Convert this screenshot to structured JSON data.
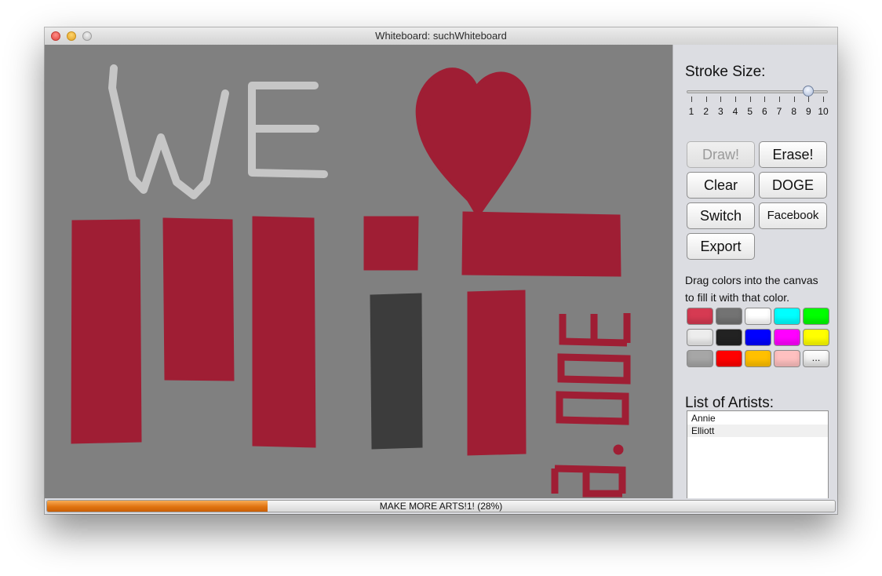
{
  "window": {
    "title": "Whiteboard: suchWhiteboard"
  },
  "controls": {
    "stroke_label": "Stroke Size:",
    "stroke": {
      "min": 1,
      "max": 10,
      "value": 9,
      "ticks": [
        "1",
        "2",
        "3",
        "4",
        "5",
        "6",
        "7",
        "8",
        "9",
        "10"
      ]
    },
    "buttons": {
      "draw": "Draw!",
      "erase": "Erase!",
      "clear": "Clear",
      "doge": "DOGE",
      "switch": "Switch",
      "facebook": "Facebook",
      "export": "Export"
    },
    "hint_line1": "Drag colors into the canvas",
    "hint_line2": "to fill it with that color.",
    "palette": [
      "#d63a52",
      "#737373",
      "#ffffff",
      "#00ffff",
      "#00ff00",
      "#ededed",
      "#222222",
      "#0000ff",
      "#ff00ff",
      "#ffff00",
      "#a6a6a6",
      "#ff0000",
      "#ffc000",
      "#ffc0c0"
    ],
    "palette_more": "...",
    "artists_label": "List of Artists:",
    "artists": [
      "Annie",
      "Elliott"
    ]
  },
  "canvas": {
    "background": "#808080",
    "ink": {
      "red": "#9f1e34",
      "light": "#c6c6c6",
      "dark": "#3c3c3c"
    }
  },
  "progress": {
    "text": "MAKE MORE ARTS!1! (28%)",
    "fraction": 0.28
  }
}
